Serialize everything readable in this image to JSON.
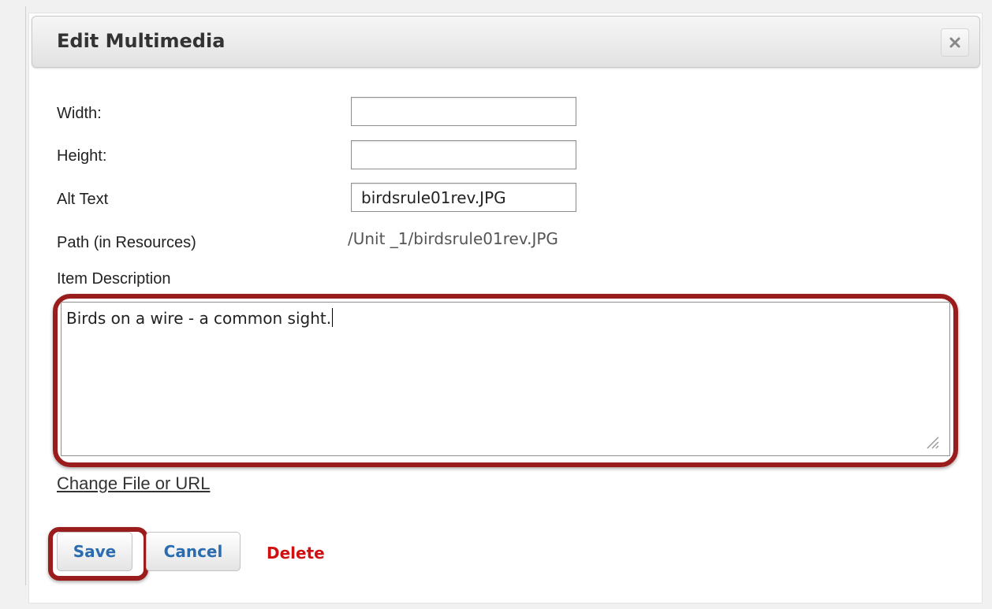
{
  "dialog": {
    "title": "Edit Multimedia",
    "close_icon": "close-icon"
  },
  "form": {
    "width_label": "Width:",
    "width_value": "",
    "height_label": "Height:",
    "height_value": "",
    "alt_label": "Alt Text",
    "alt_value": "birdsrule01rev.JPG",
    "path_label": "Path (in Resources)",
    "path_value": "/Unit _1/birdsrule01rev.JPG",
    "description_label": "Item Description",
    "description_value": "Birds on a wire - a common sight."
  },
  "links": {
    "change_file": "Change File or URL"
  },
  "actions": {
    "save": "Save",
    "cancel": "Cancel",
    "delete": "Delete"
  },
  "colors": {
    "highlight": "#9b1c1c",
    "button_text": "#2b6cb0",
    "delete_text": "#d01111"
  }
}
